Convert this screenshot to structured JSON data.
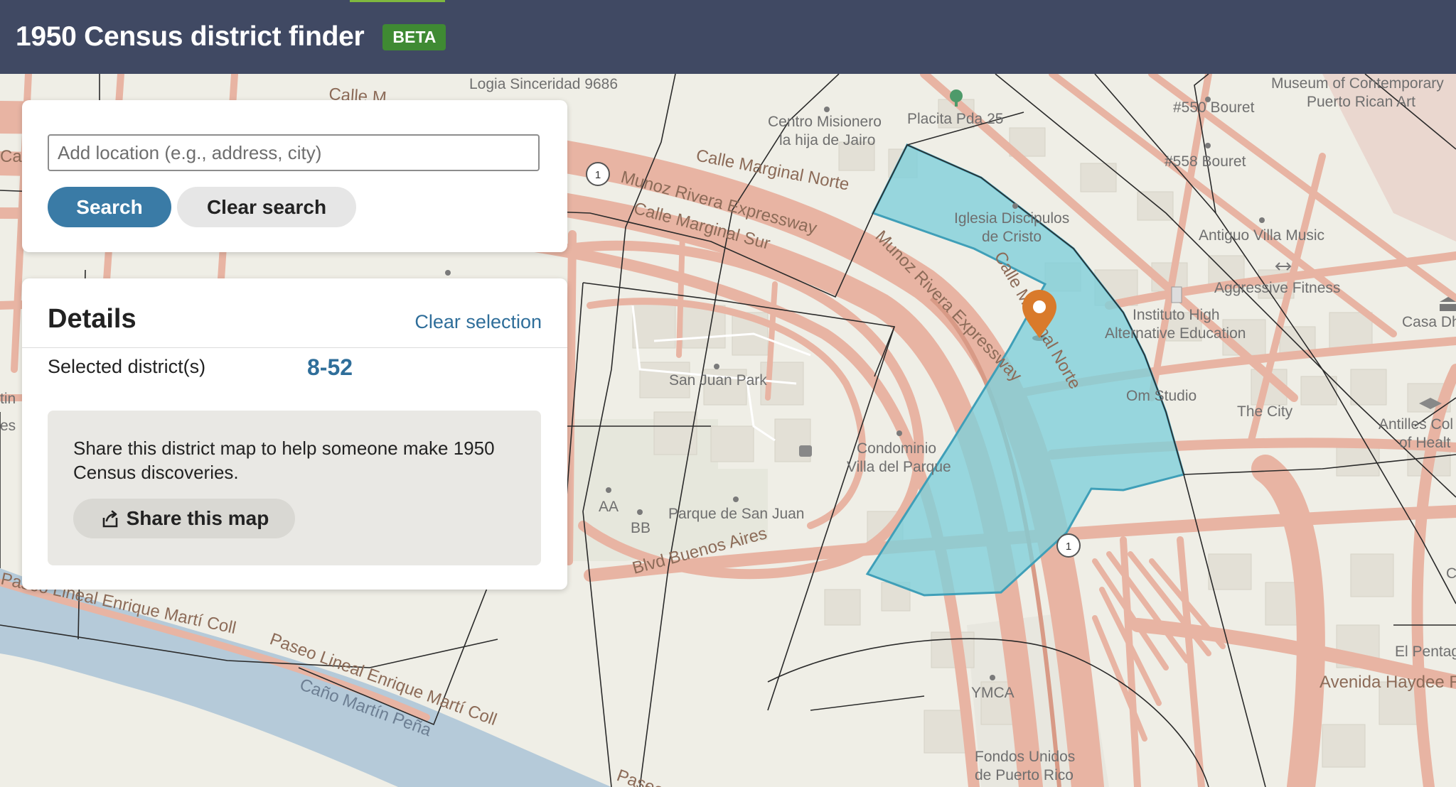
{
  "header": {
    "title": "1950 Census district finder",
    "badge": "BETA",
    "accent_color": "#7fb83f",
    "bar_color": "#404963"
  },
  "search": {
    "placeholder": "Add location (e.g., address, city)",
    "value": "",
    "search_label": "Search",
    "clear_label": "Clear search"
  },
  "details": {
    "title": "Details",
    "clear_selection_label": "Clear selection",
    "selected_label": "Selected district(s)",
    "selected_value": "8-52",
    "share_text": "Share this district map to help someone make 1950 Census discoveries.",
    "share_button_label": "Share this map"
  },
  "map": {
    "selected_district_color": "#7ecfda",
    "marker_color": "#d97a2b",
    "road_labels": {
      "calle_m": "Calle M",
      "calle_marginal_norte": "Calle Marginal Norte",
      "munoz_rivera_1": "Munoz Rivera Expressway",
      "calle_marginal_sur": "Calle Marginal Sur",
      "munoz_rivera_2": "Munoz Rivera Expressway",
      "calle_marginal_norte_2": "Calle Marginal Norte",
      "blvd_buenos_aires": "Blvd Buenos Aires",
      "paseo_lineal_1": "Paseo Lineal Enrique Martí Coll",
      "paseo_lineal_2": "Paseo Lineal Enrique Martí Coll",
      "avenida_haydee": "Avenida Haydee R",
      "paseo_bottom": "Paseo",
      "calle_left": "Calle R"
    },
    "water_label": "Caño Martín Peña",
    "route_shield": "1",
    "places": {
      "logia": "Logia Sinceridad 9686",
      "centro_1": "Centro Misionero",
      "centro_2": "la hija de Jairo",
      "placita": "Placita Pda 25",
      "museum_1": "Museum of Contemporary",
      "museum_2": "Puerto Rican Art",
      "bouret_550": "#550 Bouret",
      "bouret_558": "#558 Bouret",
      "iglesia_1": "Iglesia Discipulos",
      "iglesia_2": "de Cristo",
      "antiguo": "Antiguo Villa Music",
      "aggressive": "Aggressive Fitness",
      "casa": "Casa Dh",
      "instituto_1": "Instituto High",
      "instituto_2": "Alternative Education",
      "san_juan_park": "San Juan Park",
      "om_studio": "Om Studio",
      "the_city": "The City",
      "antilles_1": "Antilles Col",
      "antilles_2": "of Healt",
      "condominio_1": "Condominio",
      "condominio_2": "Villa del Parque",
      "aa": "AA",
      "bb": "BB",
      "parque": "Parque de San Juan",
      "el_pentag": "El Pentag",
      "ymca": "YMCA",
      "fondos_1": "Fondos Unidos",
      "fondos_2": "de Puerto Rico",
      "edge_tin": "tin",
      "edge_es": "es",
      "edge_c": "C"
    }
  }
}
